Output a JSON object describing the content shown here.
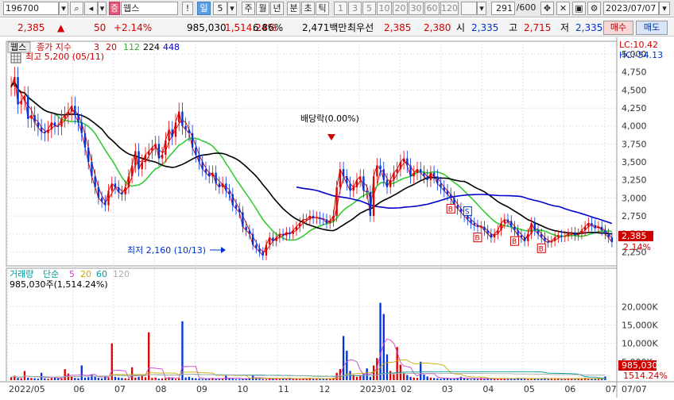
{
  "toolbar": {
    "code": "196700",
    "name": "웹스",
    "period_buttons": [
      "일",
      "5",
      "주",
      "월",
      "년",
      "분",
      "초",
      "틱"
    ],
    "number_buttons": [
      "1",
      "3",
      "5",
      "10",
      "20",
      "30",
      "60",
      "120"
    ],
    "count": "291",
    "count_total": "/600",
    "date": "2023/07/07"
  },
  "quote": {
    "price": "2,385",
    "change": "50",
    "change_pct": "+2.14%",
    "volume": "985,030",
    "volume_pct": "1,514.24%",
    "turnover_pct": "6.86%",
    "amount": "2,471백만",
    "best_ask_label": "최우선",
    "best_ask": "2,385",
    "best_bid": "2,380",
    "open_label": "시",
    "open": "2,335",
    "high_label": "고",
    "high": "2,715",
    "low_label": "저",
    "low": "2,335",
    "buy_label": "매수",
    "sell_label": "매도"
  },
  "price_panel": {
    "legend_tab": "웹스",
    "legend_title": "종가 지수",
    "ma_periods": [
      "3",
      "20",
      "112",
      "224",
      "448"
    ],
    "ma_colors": [
      "#cc0000",
      "#cc0000",
      "#33cc33",
      "#000000",
      "#0000cc"
    ],
    "high_note": "최고 5,200 (05/11)",
    "low_note": "최저 2,160 (10/13)",
    "dividend_note": "배당락(0.00%)",
    "lc": "LC:10.42",
    "hc": "HC:-54.13",
    "last_price": "2,385",
    "last_pct": "2.14%",
    "signals": [
      "B",
      "B",
      "S",
      "B",
      "B"
    ]
  },
  "volume_panel": {
    "legend_title": "거래량",
    "legend_sub": "단순",
    "ma_periods": [
      "5",
      "20",
      "60",
      "120"
    ],
    "ma_colors": [
      "#cc44cc",
      "#ccaa00",
      "#009999",
      "#aaaaaa"
    ],
    "current": "985,030주(1,514.24%)",
    "last_volume": "985,030",
    "last_pct": "1514.24%"
  },
  "x_axis": {
    "labels": [
      "2022/05",
      "06",
      "07",
      "08",
      "09",
      "10",
      "11",
      "12",
      "2023/01",
      "02",
      "03",
      "04",
      "05",
      "06",
      "07"
    ],
    "cursor_label": "07/07"
  },
  "chart_data": {
    "type": "candlestick",
    "y_price_ticks": [
      "5,000",
      "4,750",
      "4,500",
      "4,250",
      "4,000",
      "3,750",
      "3,500",
      "3,250",
      "3,000",
      "2,750",
      "2,500",
      "2,250"
    ],
    "y_volume_ticks": [
      "20,000K",
      "15,000K",
      "10,000K",
      "5,000K"
    ],
    "price_range": [
      2100,
      5100
    ],
    "volume_range": [
      0,
      22000
    ],
    "close": [
      4550,
      4680,
      4300,
      4350,
      4420,
      4100,
      4150,
      4050,
      3980,
      3920,
      3900,
      3950,
      4050,
      4000,
      3990,
      4100,
      4150,
      4200,
      4280,
      4150,
      4050,
      3900,
      3700,
      3500,
      3300,
      3150,
      3000,
      2950,
      2900,
      3100,
      3200,
      3150,
      3080,
      3050,
      3150,
      3300,
      3450,
      3650,
      3400,
      3500,
      3600,
      3650,
      3700,
      3750,
      3550,
      3600,
      3800,
      3950,
      3850,
      4050,
      4200,
      4000,
      3950,
      3900,
      3700,
      3600,
      3500,
      3400,
      3350,
      3300,
      3350,
      3200,
      3150,
      3200,
      3100,
      3050,
      2900,
      2850,
      2800,
      2600,
      2550,
      2500,
      2350,
      2300,
      2250,
      2200,
      2350,
      2450,
      2400,
      2450,
      2500,
      2480,
      2520,
      2500,
      2550,
      2600,
      2650,
      2700,
      2700,
      2750,
      2720,
      2730,
      2710,
      2700,
      2650,
      2680,
      2750,
      3150,
      3400,
      3300,
      3200,
      3100,
      3150,
      3250,
      3300,
      3100,
      3080,
      2750,
      3300,
      3450,
      3400,
      3250,
      3150,
      3250,
      3350,
      3400,
      3500,
      3550,
      3450,
      3300,
      3350,
      3400,
      3350,
      3300,
      3250,
      3350,
      3300,
      3200,
      3150,
      3100,
      3050,
      3000,
      2900,
      2850,
      2800,
      2750,
      2700,
      2650,
      2620,
      2600,
      2600,
      2550,
      2500,
      2450,
      2500,
      2550,
      2650,
      2700,
      2680,
      2600,
      2550,
      2480,
      2450,
      2400,
      2500,
      2650,
      2550,
      2500,
      2450,
      2400,
      2380,
      2400,
      2450,
      2480,
      2460,
      2470,
      2500,
      2520,
      2480,
      2500,
      2550,
      2600,
      2650,
      2620,
      2580,
      2600,
      2550,
      2500,
      2450,
      2385
    ],
    "volume": [
      800,
      1200,
      600,
      500,
      2500,
      700,
      600,
      500,
      400,
      2000,
      500,
      400,
      600,
      700,
      500,
      400,
      3000,
      1800,
      900,
      600,
      500,
      4000,
      700,
      800,
      1500,
      900,
      600,
      500,
      1200,
      700,
      10000,
      900,
      700,
      600,
      500,
      400,
      3500,
      700,
      900,
      1200,
      800,
      13000,
      600,
      700,
      400,
      500,
      600,
      800,
      700,
      400,
      500,
      16000,
      700,
      900,
      600,
      500,
      400,
      300,
      400,
      500,
      600,
      400,
      300,
      400,
      1200,
      500,
      400,
      300,
      300,
      400,
      500,
      600,
      1200,
      500,
      400,
      300,
      300,
      600,
      500,
      400,
      300,
      400,
      500,
      600,
      300,
      400,
      300,
      500,
      400,
      600,
      300,
      400,
      500,
      300,
      400,
      500,
      600,
      2000,
      3000,
      12000,
      8000,
      2500,
      1500,
      900,
      1200,
      1800,
      3200,
      900,
      4000,
      6000,
      21000,
      18000,
      7000,
      2500,
      1600,
      9000,
      4200,
      2000,
      1400,
      900,
      700,
      600,
      5000,
      1500,
      1000,
      700,
      600,
      500,
      400,
      500,
      600,
      400,
      500,
      600,
      900,
      500,
      400,
      300,
      400,
      500,
      600,
      500,
      400,
      300,
      400,
      300,
      500,
      400,
      300,
      400,
      500,
      600,
      500,
      400,
      300,
      500,
      400,
      300,
      400,
      600,
      500,
      400,
      300,
      400,
      300,
      400,
      500,
      400,
      300,
      500,
      400,
      600,
      300,
      400,
      500,
      400,
      300,
      985
    ]
  }
}
